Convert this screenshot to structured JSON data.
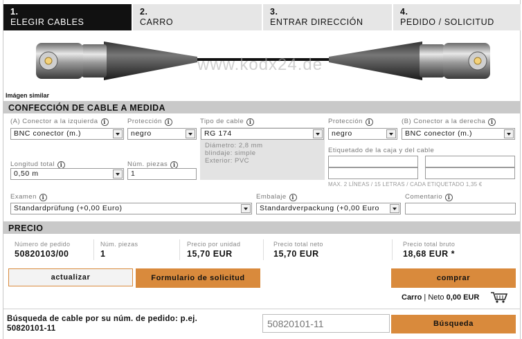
{
  "steps": [
    {
      "num": "1.",
      "label": "ELEGIR CABLES"
    },
    {
      "num": "2.",
      "label": "CARRO"
    },
    {
      "num": "3.",
      "label": "ENTRAR DIRECCIÓN"
    },
    {
      "num": "4.",
      "label": "PEDIDO / SOLICITUD"
    }
  ],
  "image": {
    "watermark": "www.kodx24.de",
    "caption": "Imágen similar"
  },
  "config": {
    "title": "CONFECCIÓN DE CABLE A MEDIDA",
    "left_connector": {
      "label": "(A) Conector a la izquierda",
      "value": "BNC conector (m.)"
    },
    "protection_left": {
      "label": "Protección",
      "value": "negro"
    },
    "cable_type": {
      "label": "Tipo de cable",
      "value": "RG 174",
      "specs": [
        "Diámetro: 2,8 mm",
        "blindaje: simple",
        "Exterior: PVC"
      ]
    },
    "protection_right": {
      "label": "Protección",
      "value": "negro"
    },
    "right_connector": {
      "label": "(B) Conector a la derecha",
      "value": "BNC conector (m.)"
    },
    "length": {
      "label": "Longitud total",
      "value": "0,50 m"
    },
    "pieces": {
      "label": "Núm. piezas",
      "value": "1"
    },
    "labeling": {
      "label": "Etiquetado de la caja y del cable",
      "note": "MAX. 2 LÍNEAS / 15 LETRAS / CADA ETIQUETADO 1,35 €"
    },
    "exam": {
      "label": "Examen",
      "value": "Standardprüfung (+0,00 Euro)"
    },
    "packaging": {
      "label": "Embalaje",
      "value": "Standardverpackung (+0,00 Euro"
    },
    "comment": {
      "label": "Comentario",
      "value": ""
    }
  },
  "price": {
    "title": "PRECIO",
    "order_no": {
      "label": "Número de pedido",
      "value": "50820103/00"
    },
    "pieces": {
      "label": "Núm. piezas",
      "value": "1"
    },
    "unit": {
      "label": "Precio por unidad",
      "value": "15,70 EUR"
    },
    "net": {
      "label": "Precio total neto",
      "value": "15,70 EUR"
    },
    "gross": {
      "label": "Precio total bruto",
      "value": "18,68 EUR *"
    }
  },
  "buttons": {
    "update": "actualizar",
    "form": "Formulario de solicitud",
    "buy": "comprar",
    "search": "Búsqueda"
  },
  "cart": {
    "label": "Carro",
    "sep": " | Neto ",
    "amount": "0,00 EUR"
  },
  "search": {
    "prompt_line1": "Búsqueda de cable por su núm. de pedido: p.ej.",
    "prompt_line2": "50820101-11",
    "placeholder": "50820101-11"
  },
  "colors": {
    "accent": "#d98a3c",
    "active_step": "#111111",
    "section": "#c9c9c9"
  }
}
